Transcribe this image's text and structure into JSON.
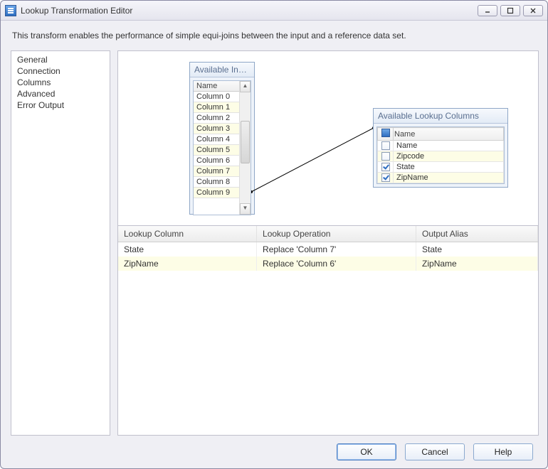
{
  "window": {
    "title": "Lookup Transformation Editor",
    "description": "This transform enables the performance of simple equi-joins between the input and a reference data set."
  },
  "sidebar": {
    "items": [
      {
        "label": "General"
      },
      {
        "label": "Connection"
      },
      {
        "label": "Columns"
      },
      {
        "label": "Advanced"
      },
      {
        "label": "Error Output"
      }
    ]
  },
  "inputColumns": {
    "title": "Available Inpu…",
    "nameHeader": "Name",
    "rows": [
      "Column 0",
      "Column 1",
      "Column 2",
      "Column 3",
      "Column 4",
      "Column 5",
      "Column 6",
      "Column 7",
      "Column 8",
      "Column 9"
    ]
  },
  "lookupColumns": {
    "title": "Available Lookup Columns",
    "nameHeader": "Name",
    "rows": [
      {
        "label": "Name",
        "checked": false
      },
      {
        "label": "Zipcode",
        "checked": false
      },
      {
        "label": "State",
        "checked": true
      },
      {
        "label": "ZipName",
        "checked": true
      }
    ]
  },
  "grid": {
    "headers": {
      "col1": "Lookup Column",
      "col2": "Lookup Operation",
      "col3": "Output Alias"
    },
    "rows": [
      {
        "c1": "State",
        "c2": "Replace 'Column 7'",
        "c3": "State"
      },
      {
        "c1": "ZipName",
        "c2": "Replace 'Column 6'",
        "c3": "ZipName"
      }
    ]
  },
  "buttons": {
    "ok": "OK",
    "cancel": "Cancel",
    "help": "Help"
  }
}
